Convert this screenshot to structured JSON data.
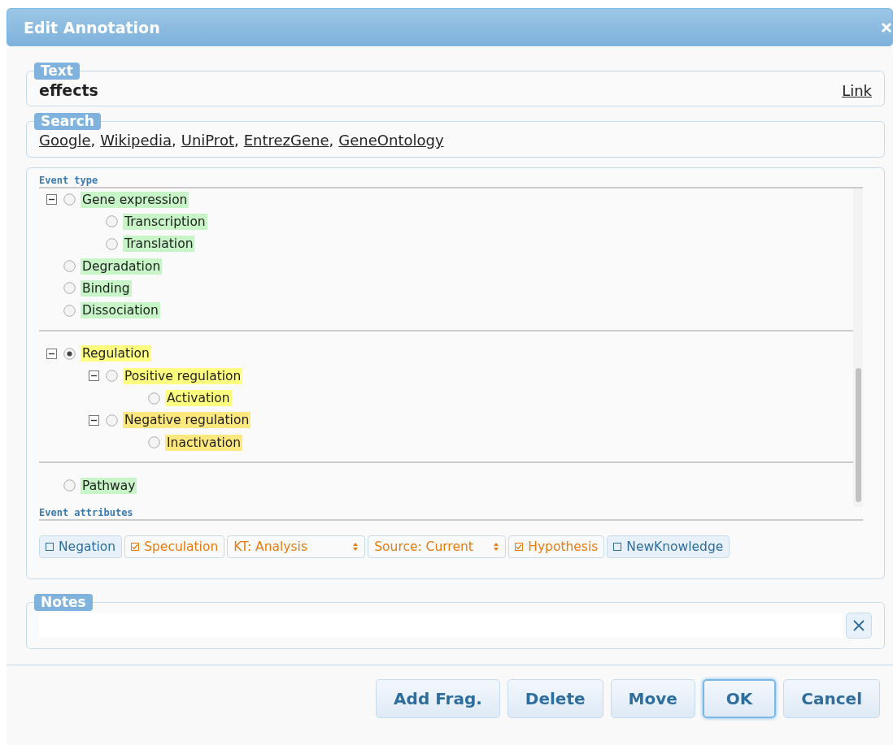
{
  "dialog": {
    "title": "Edit Annotation"
  },
  "text_section": {
    "legend": "Text",
    "value": "effects",
    "link": "Link"
  },
  "search_section": {
    "legend": "Search",
    "links": [
      {
        "label": "Google",
        "separator": ","
      },
      {
        "label": "Wikipedia",
        "separator": ","
      },
      {
        "label": "UniProt",
        "separator": ","
      },
      {
        "label": "EntrezGene",
        "separator": ","
      },
      {
        "label": "GeneOntology"
      }
    ]
  },
  "event_type": {
    "heading": "Event type",
    "groups": [
      {
        "items": [
          {
            "label": "Gene expression",
            "selected": false,
            "expanded": true,
            "color": "#c8f5c8",
            "children": [
              {
                "label": "Transcription",
                "selected": false,
                "color": "#c8f5c8"
              },
              {
                "label": "Translation",
                "selected": false,
                "color": "#c8f5c8"
              }
            ]
          },
          {
            "label": "Degradation",
            "selected": false,
            "color": "#c8f5c8"
          },
          {
            "label": "Binding",
            "selected": false,
            "color": "#c8f5c8"
          },
          {
            "label": "Dissociation",
            "selected": false,
            "color": "#c8f5c8"
          }
        ]
      },
      {
        "items": [
          {
            "label": "Regulation",
            "selected": true,
            "expanded": true,
            "color": "#ffff80",
            "children": [
              {
                "label": "Positive regulation",
                "selected": false,
                "expanded": true,
                "color": "#ffff80",
                "children": [
                  {
                    "label": "Activation",
                    "selected": false,
                    "color": "#ffff80"
                  }
                ]
              },
              {
                "label": "Negative regulation",
                "selected": false,
                "expanded": true,
                "color": "#ffe97f",
                "children": [
                  {
                    "label": "Inactivation",
                    "selected": false,
                    "color": "#ffe97f"
                  }
                ]
              }
            ]
          }
        ]
      },
      {
        "items": [
          {
            "label": "Pathway",
            "selected": false,
            "color": "#c8f5c8"
          }
        ]
      }
    ]
  },
  "event_attributes": {
    "heading": "Event attributes",
    "items": [
      {
        "kind": "checkbox",
        "label": "Negation",
        "checked": false
      },
      {
        "kind": "checkbox",
        "label": "Speculation",
        "checked": true
      },
      {
        "kind": "select",
        "label": "KT: Analysis"
      },
      {
        "kind": "select",
        "label": "Source: Current"
      },
      {
        "kind": "checkbox",
        "label": "Hypothesis",
        "checked": true
      },
      {
        "kind": "checkbox",
        "label": "NewKnowledge",
        "checked": false
      }
    ]
  },
  "notes_section": {
    "legend": "Notes"
  },
  "buttons": [
    {
      "label": "Add Frag.",
      "focused": false
    },
    {
      "label": "Delete",
      "focused": false
    },
    {
      "label": "Move",
      "focused": false
    },
    {
      "label": "OK",
      "focused": true
    },
    {
      "label": "Cancel",
      "focused": false
    }
  ]
}
